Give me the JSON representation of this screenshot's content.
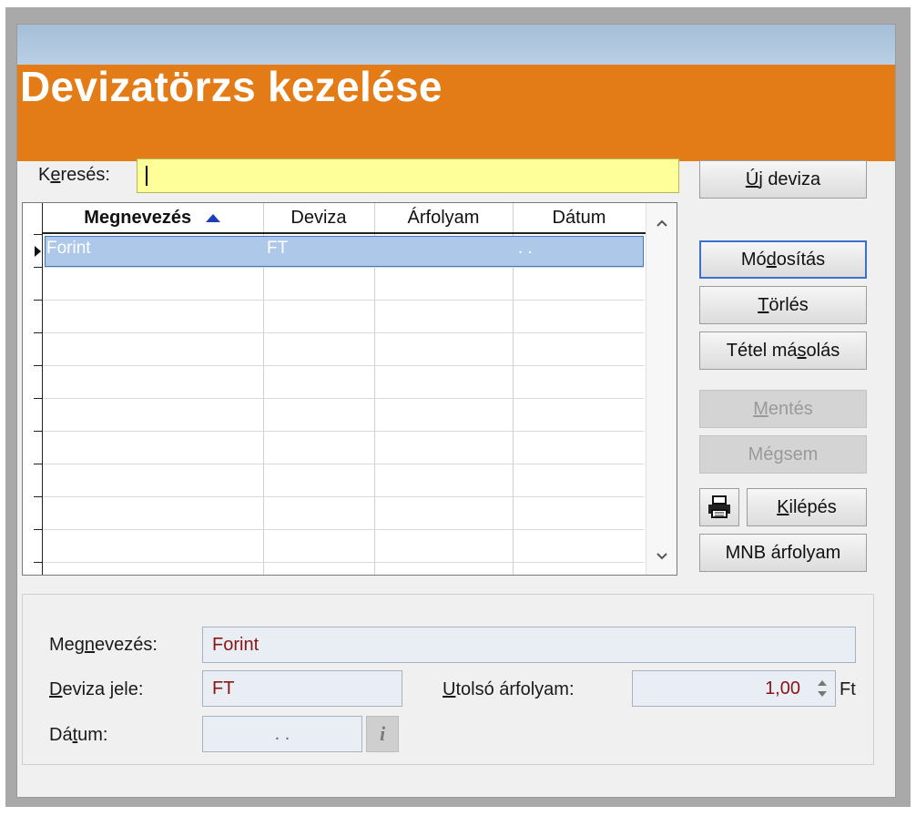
{
  "window": {
    "title": "Devizatörzs kezelése"
  },
  "search": {
    "label_pre": "K",
    "label_key": "e",
    "label_post": "resés:",
    "value": ""
  },
  "grid": {
    "columns": [
      {
        "label": "Megnevezés",
        "sorted": "ascending"
      },
      {
        "label": "Deviza"
      },
      {
        "label": "Árfolyam"
      },
      {
        "label": "Dátum"
      }
    ],
    "rows": [
      {
        "megnevezes": "Forint",
        "deviza": "FT",
        "arfolyam": "",
        "datum": ". ."
      }
    ],
    "sort_icon": "triangle-up-icon",
    "scroll_up_icon": "chevron-up-icon",
    "scroll_down_icon": "chevron-down-icon"
  },
  "buttons": {
    "new": {
      "pre": "",
      "key": "Ú",
      "post": "j deviza"
    },
    "modify": {
      "pre": "Mó",
      "key": "d",
      "post": "osítás"
    },
    "delete": {
      "pre": "",
      "key": "T",
      "post": "örlés"
    },
    "copy": {
      "pre": "Tétel má",
      "key": "s",
      "post": "olás"
    },
    "save": {
      "pre": "",
      "key": "M",
      "post": "entés"
    },
    "cancel": {
      "pre": "Mé",
      "key": "g",
      "post": "sem"
    },
    "exit": {
      "pre": "",
      "key": "K",
      "post": "ilépés"
    },
    "mnb": {
      "label": "MNB árfolyam"
    },
    "print_icon": "printer-icon"
  },
  "detail": {
    "name_label": {
      "pre": "Meg",
      "key": "n",
      "post": "evezés:"
    },
    "name_value": "Forint",
    "code_label": {
      "pre": "",
      "key": "D",
      "post": "eviza jele:"
    },
    "code_value": "FT",
    "rate_label": {
      "pre": "",
      "key": "U",
      "post": "tolsó árfolyam:"
    },
    "rate_value": "1,00",
    "rate_unit": "Ft",
    "date_label": {
      "pre": "Dá",
      "key": "t",
      "post": "um:"
    },
    "date_value": ". .",
    "info_icon": "info-icon",
    "info_glyph": "i"
  },
  "colors": {
    "banner": "#e37b17",
    "search_bg": "#ffff99",
    "selection": "#aec8ea",
    "field_text": "#8b1414"
  }
}
